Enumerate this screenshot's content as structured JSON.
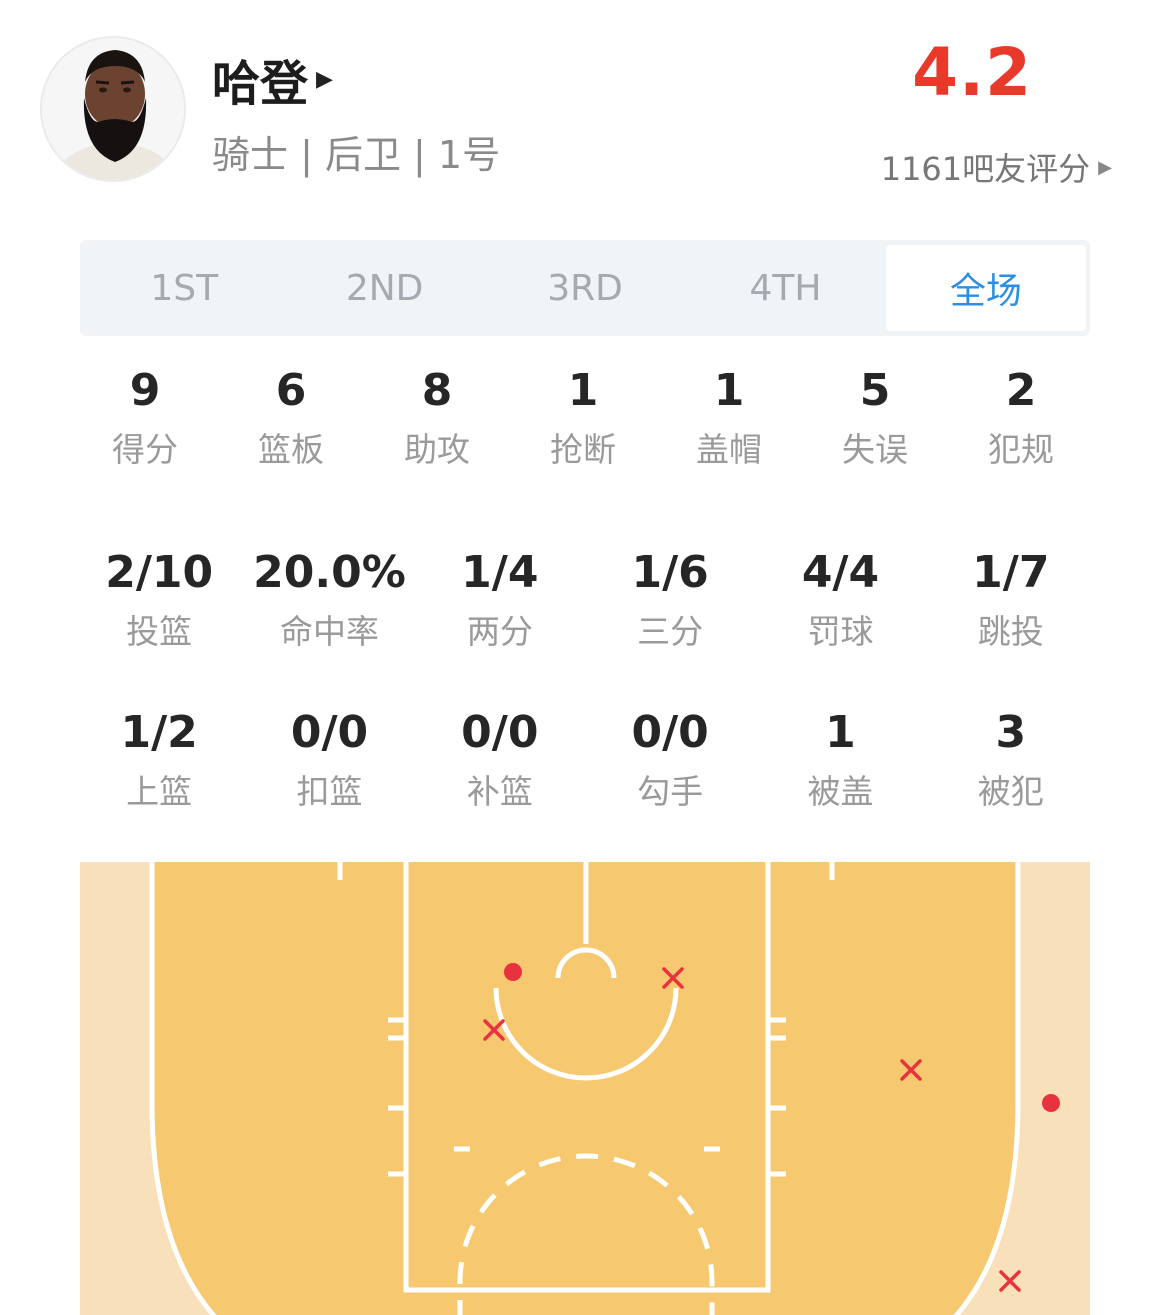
{
  "player": {
    "name": "哈登",
    "meta": "骑士 | 后卫 | 1号",
    "rating": "4.2",
    "rating_count": "1161吧友评分",
    "arrow_icon": "caret-right-icon"
  },
  "tabs": [
    {
      "label": "1ST"
    },
    {
      "label": "2ND"
    },
    {
      "label": "3RD"
    },
    {
      "label": "4TH"
    },
    {
      "label": "全场",
      "active": true
    }
  ],
  "stats_main": [
    {
      "value": "9",
      "label": "得分"
    },
    {
      "value": "6",
      "label": "篮板"
    },
    {
      "value": "8",
      "label": "助攻"
    },
    {
      "value": "1",
      "label": "抢断"
    },
    {
      "value": "1",
      "label": "盖帽"
    },
    {
      "value": "5",
      "label": "失误"
    },
    {
      "value": "2",
      "label": "犯规"
    }
  ],
  "stats_shooting": [
    {
      "value": "2/10",
      "label": "投篮"
    },
    {
      "value": "20.0%",
      "label": "命中率"
    },
    {
      "value": "1/4",
      "label": "两分"
    },
    {
      "value": "1/6",
      "label": "三分"
    },
    {
      "value": "4/4",
      "label": "罚球"
    },
    {
      "value": "1/7",
      "label": "跳投"
    }
  ],
  "stats_other": [
    {
      "value": "1/2",
      "label": "上篮"
    },
    {
      "value": "0/0",
      "label": "扣篮"
    },
    {
      "value": "0/0",
      "label": "补篮"
    },
    {
      "value": "0/0",
      "label": "勾手"
    },
    {
      "value": "1",
      "label": "被盖"
    },
    {
      "value": "3",
      "label": "被犯"
    }
  ],
  "shot_chart": {
    "made_color": "#e8333f",
    "miss_color": "#e8333f",
    "court_color": "#f6c870",
    "outer_color": "#f8e0bb",
    "line_color": "#ffffff",
    "shots": [
      {
        "result": "made"
      },
      {
        "result": "missed"
      },
      {
        "result": "missed"
      },
      {
        "result": "missed"
      },
      {
        "result": "made"
      },
      {
        "result": "missed"
      }
    ]
  }
}
